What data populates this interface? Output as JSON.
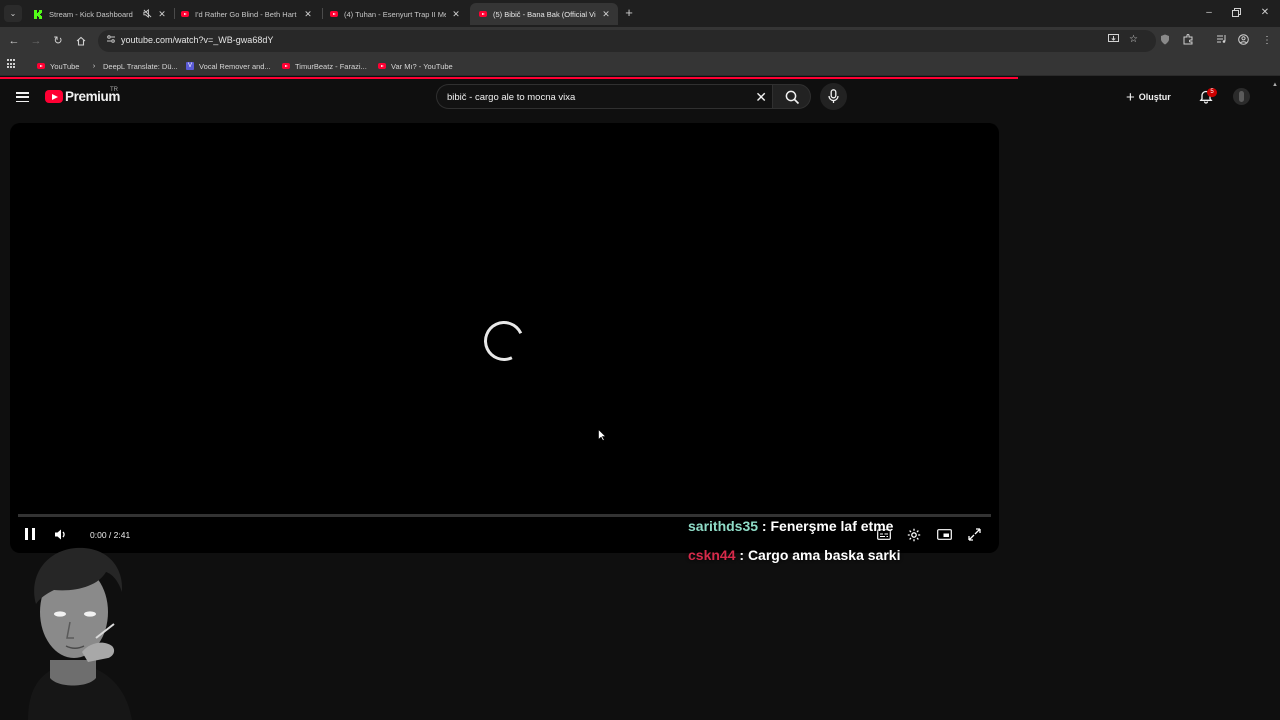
{
  "browser": {
    "tabs": [
      {
        "title": "Stream - Kick Dashboard",
        "muted_icon": "speaker-muted-icon",
        "active": false
      },
      {
        "title": "I'd Rather Go Blind - Beth Hart",
        "active": false
      },
      {
        "title": "(4) Tuhan - Esenyurt Trap II Me",
        "active": false
      },
      {
        "title": "(5) Bibič - Bana Bak (Official Vid",
        "active": true
      }
    ],
    "url": "youtube.com/watch?v=_WB-gwa68dY",
    "bookmarks": [
      {
        "label": "YouTube"
      },
      {
        "label": "DeepL Translate: Dü..."
      },
      {
        "label": "Vocal Remover and..."
      },
      {
        "label": "TimurBeatz - Farazi..."
      },
      {
        "label": "Var Mı? - YouTube"
      }
    ],
    "colors": {
      "accent": "#ff0033",
      "tabstrip": "#1f1f1f",
      "toolbar": "#353535"
    }
  },
  "youtube": {
    "brand": "Premium",
    "country": "TR",
    "search_query": "bibič - cargo ale to mocna vixa",
    "create_label": "Oluştur",
    "notification_count": "5",
    "player": {
      "state": "loading",
      "time": "0:00 / 2:41",
      "progress": 0
    }
  },
  "chat": [
    {
      "user": "sarithds35",
      "user_color": "#8fdcc7",
      "message": "Fenerşme laf etme"
    },
    {
      "user": "cskn44",
      "user_color": "#d62a4a",
      "message": "Cargo ama baska sarki"
    }
  ],
  "webcam": {
    "description_icon": "streamer-webcam"
  }
}
